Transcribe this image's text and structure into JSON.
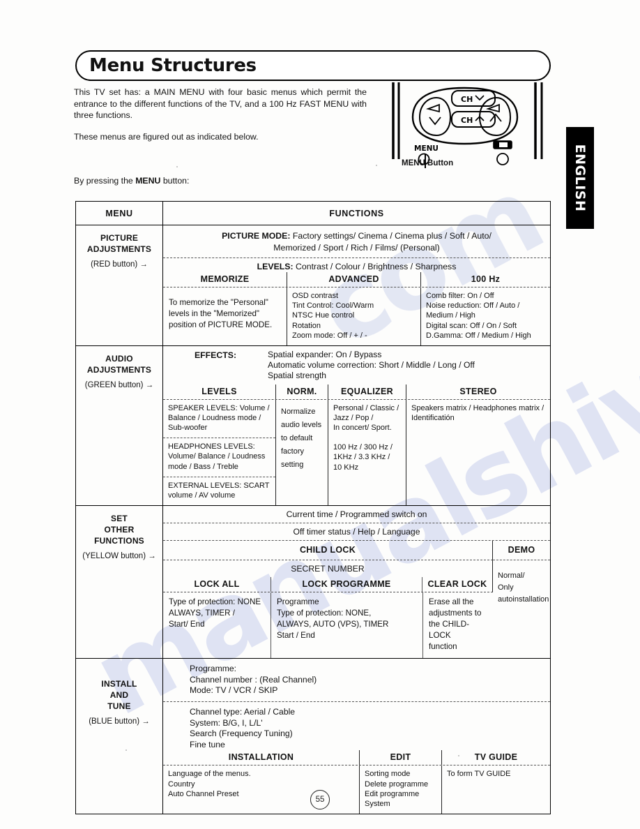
{
  "document": {
    "page_title": "Menu Structures",
    "page_number": "55",
    "language_tab": "ENGLISH"
  },
  "intro": {
    "paragraph1_pre": "This TV set has: a MAIN MENU with four basic menus which permit the entrance to the different functions of the TV, and a 100 Hz FAST MENU with three functions.",
    "paragraph2": "These menus are figured out as indicated below."
  },
  "remote": {
    "menu_label": "MENU",
    "ch_up_label": "CH",
    "ch_down_label": "CH",
    "caption": "MENU Button"
  },
  "instruction": {
    "prefix": "By pressing the ",
    "bold": "MENU",
    "suffix": " button:"
  },
  "table": {
    "headers": {
      "menu": "MENU",
      "functions": "FUNCTIONS"
    },
    "sections": [
      {
        "menu_title_line1": "PICTURE",
        "menu_title_line2": "ADJUSTMENTS",
        "menu_button": "(RED button) →",
        "picture_mode_label": "PICTURE MODE:",
        "picture_mode_line1": " Factory settings/ Cinema / Cinema plus / Soft / Auto/",
        "picture_mode_line2": "Memorized / Sport / Rich / Films/ (Personal)",
        "levels_label": "LEVELS:",
        "levels_value": " Contrast / Colour / Brightness / Sharpness",
        "col_memorize_title": "MEMORIZE",
        "col_advanced_title": "ADVANCED",
        "col_100hz_title": "100 Hz",
        "memorize_body": "To memorize the \"Personal\" levels in the \"Memorized\" position of PICTURE MODE.",
        "advanced_items": [
          "OSD contrast",
          "Tint Control: Cool/Warm",
          "NTSC Hue control",
          "Rotation",
          "Zoom mode: Off / + / -"
        ],
        "hz_items": [
          "Comb filter: On / Off",
          "Noise reduction: Off / Auto /",
          "Medium / High",
          "Digital scan: Off / On / Soft",
          "D.Gamma: Off / Medium / High"
        ]
      },
      {
        "menu_title_line1": "AUDIO",
        "menu_title_line2": "ADJUSTMENTS",
        "menu_button": "(GREEN button) →",
        "effects_label": "EFFECTS:",
        "effects_items": [
          "Spatial expander: On / Bypass",
          "Automatic volume correction: Short / Middle / Long / Off",
          "Spatial strength"
        ],
        "col_levels_title": "LEVELS",
        "col_norm_title": "NORM.",
        "col_equalizer_title": "EQUALIZER",
        "col_stereo_title": "STEREO",
        "levels_rows": [
          "SPEAKER LEVELS: Volume / Balance / Loudness mode / Sub-woofer",
          "HEADPHONES LEVELS: Volume/ Balance / Loudness mode / Bass / Treble",
          "EXTERNAL LEVELS: SCART volume / AV volume"
        ],
        "norm_body": "Normalize audio levels to default factory setting",
        "equalizer_group1": [
          "Personal / Classic /",
          "Jazz / Pop /",
          "In concert/ Sport."
        ],
        "equalizer_group2": [
          "100 Hz / 300 Hz /",
          "1KHz / 3.3 KHz /",
          "10 KHz"
        ],
        "stereo_body": "Speakers matrix / Headphones matrix / Identificatión"
      },
      {
        "menu_title_line1": "SET",
        "menu_title_line2": "OTHER",
        "menu_title_line3": "FUNCTIONS",
        "menu_button": "(YELLOW button) →",
        "line_current_time": "Current time / Programmed switch on",
        "line_off_timer": "Off timer status / Help / Language",
        "child_lock_title": "CHILD LOCK",
        "demo_title": "DEMO",
        "secret_number": "SECRET NUMBER",
        "col_lock_all_title": "LOCK ALL",
        "col_lock_programme_title": "LOCK PROGRAMME",
        "col_clear_lock_title": "CLEAR LOCK",
        "lock_all_body": [
          "Type of protection: NONE",
          "ALWAYS, TIMER /",
          "Start/ End"
        ],
        "lock_programme_body": [
          "Programme",
          "Type of protection: NONE,",
          "ALWAYS, AUTO (VPS), TIMER",
          "Start / End"
        ],
        "clear_lock_body": [
          "Erase all the",
          "adjustments to",
          "the CHILD-LOCK",
          "function"
        ],
        "demo_body": [
          "Normal/",
          "Only",
          "autoinstallation"
        ]
      },
      {
        "menu_title_line1": "INSTALL",
        "menu_title_line2": "AND",
        "menu_title_line3": "TUNE",
        "menu_button": "(BLUE button) →",
        "programme_block": [
          "Programme:",
          "Channel number : (Real Channel)",
          "Mode: TV / VCR / SKIP"
        ],
        "channel_block": [
          "Channel type: Aerial / Cable",
          "System: B/G, I, L/L'",
          "Search (Frequency Tuning)",
          "Fine tune"
        ],
        "col_installation_title": "INSTALLATION",
        "col_edit_title": "EDIT",
        "col_tv_guide_title": "TV GUIDE",
        "installation_body": [
          "Language of the menus.",
          "Country",
          "Auto Channel Preset"
        ],
        "edit_body": [
          "Sorting mode",
          "Delete programme",
          "Edit programme",
          "System"
        ],
        "tv_guide_body": "To form TV GUIDE"
      }
    ]
  },
  "watermark": {
    "text1": "manualshive",
    "text2": "com"
  },
  "colors": {
    "ink": "#111111",
    "watermark": "#b9c2e8",
    "tab_bg": "#000000"
  }
}
